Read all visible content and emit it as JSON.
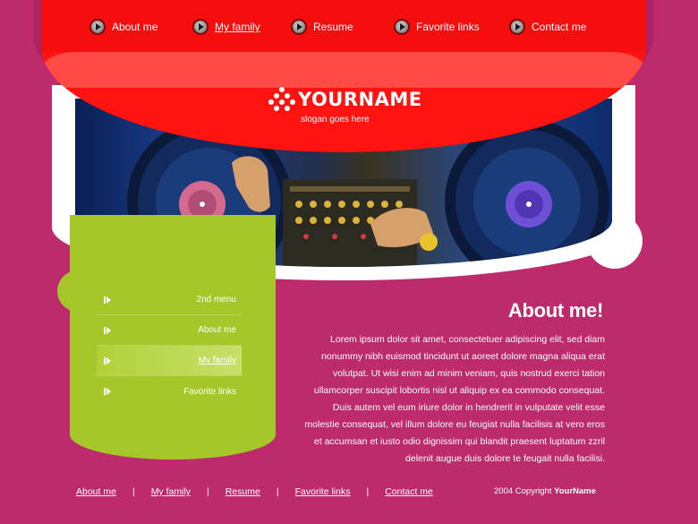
{
  "top_nav": [
    {
      "label": "About me",
      "active": false
    },
    {
      "label": "My family",
      "active": true
    },
    {
      "label": "Resume",
      "active": false
    },
    {
      "label": "Favorite links",
      "active": false
    },
    {
      "label": "Contact me",
      "active": false
    }
  ],
  "logo": {
    "name": "YOURNAME",
    "slogan": "slogan goes here"
  },
  "side_menu": [
    {
      "label": "2nd menu",
      "active": false
    },
    {
      "label": "About me",
      "active": false
    },
    {
      "label": "My family",
      "active": true
    },
    {
      "label": "Favorite links",
      "active": false
    }
  ],
  "content": {
    "title": "About me!",
    "body": "Lorem ipsum dolor sit amet, consectetuer adipiscing elit, sed diam nonummy nibh euismod tincidunt ut aoreet dolore magna aliqua erat volutpat. Ut wisi enim ad minim veniam, quis nostrud exerci tation ullamcorper suscipit lobortis nisl ut aliquip ex ea commodo consequat. Duis autem vel eum iriure dolor in hendrerit in vulputate velit esse molestie consequat, vel illum dolore eu feugiat nulla facilisis at vero eros et accumsan et iusto odio dignissim qui blandit praesent luptatum zzril delenit augue duis dolore te feugait nulla facilisi."
  },
  "footer": {
    "links": [
      "About me",
      "My family",
      "Resume",
      "Favorite links",
      "Contact me"
    ],
    "separator": "|",
    "copyright_prefix": "2004 Copyright",
    "copyright_name": "YourName"
  },
  "colors": {
    "background": "#bd2b6c",
    "header_red": "#fe1311",
    "sidebar_green": "#a6c729"
  }
}
